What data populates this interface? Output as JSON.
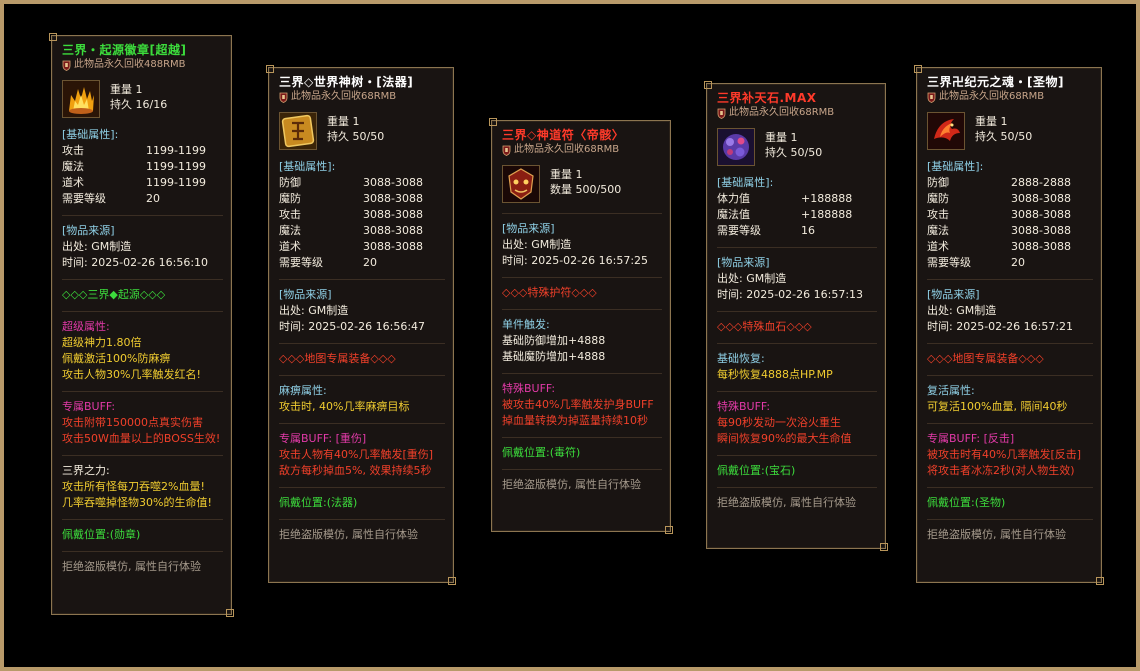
{
  "cards": [
    {
      "title": "三界・起源徽章[超越]",
      "recycle": "此物品永久回收488RMB",
      "weight": "重量 1",
      "dura": "持久 16/16",
      "base_title": "[基础属性]:",
      "attrs": [
        {
          "k": "攻击",
          "v": "1199-1199"
        },
        {
          "k": "魔法",
          "v": "1199-1199"
        },
        {
          "k": "道术",
          "v": "1199-1199"
        },
        {
          "k": "需要等级",
          "v": "20"
        }
      ],
      "source_title": "[物品来源]",
      "source_from": "出处: GM制造",
      "source_time": "时间: 2025-02-26 16:56:10",
      "green_line": "◇◇◇三界◆起源◇◇◇",
      "super_title": "超级属性:",
      "super_lines": [
        "超级神力1.80倍",
        "佩戴激活100%防麻痹",
        "攻击人物30%几率触发红名!"
      ],
      "buff_title": "专属BUFF:",
      "buff_lines": [
        "攻击附带150000点真实伤害",
        "攻击50W血量以上的BOSS生效!"
      ],
      "power_title": "三界之力:",
      "power_lines": [
        "攻击所有怪每刀吞噬2%血量!",
        "几率吞噬掉怪物30%的生命值!"
      ],
      "slot": "佩戴位置:(勋章)",
      "footer": "拒绝盗版模仿, 属性自行体验"
    },
    {
      "title": "三界◇世界神树・[法器]",
      "recycle": "此物品永久回收68RMB",
      "weight": "重量 1",
      "dura": "持久 50/50",
      "base_title": "[基础属性]:",
      "attrs": [
        {
          "k": "防御",
          "v": "3088-3088"
        },
        {
          "k": "魔防",
          "v": "3088-3088"
        },
        {
          "k": "攻击",
          "v": "3088-3088"
        },
        {
          "k": "魔法",
          "v": "3088-3088"
        },
        {
          "k": "道术",
          "v": "3088-3088"
        },
        {
          "k": "需要等级",
          "v": "20"
        }
      ],
      "source_title": "[物品来源]",
      "source_from": "出处: GM制造",
      "source_time": "时间: 2025-02-26 16:56:47",
      "red_line": "◇◇◇地图专属装备◇◇◇",
      "mb_title": "麻痹属性:",
      "mb_lines": [
        "攻击时, 40%几率麻痹目标"
      ],
      "buff_title": "专属BUFF: [重伤]",
      "buff_lines": [
        "攻击人物有40%几率触发[重伤]",
        "敌方每秒掉血5%, 效果持续5秒"
      ],
      "slot": "佩戴位置:(法器)",
      "footer": "拒绝盗版模仿, 属性自行体验"
    },
    {
      "title": "三界◇神道符〈帝骸〉",
      "recycle": "此物品永久回收68RMB",
      "weight": "重量 1",
      "dura": "数量 500/500",
      "source_title": "[物品来源]",
      "source_from": "出处: GM制造",
      "source_time": "时间: 2025-02-26 16:57:25",
      "red_line": "◇◇◇特殊护符◇◇◇",
      "single_title": "单件触发:",
      "single_lines": [
        "基础防御增加+4888",
        "基础魔防增加+4888"
      ],
      "buff_title": "特殊BUFF:",
      "buff_lines": [
        "被攻击40%几率触发护身BUFF",
        "掉血量转换为掉蓝量持续10秒"
      ],
      "slot": "佩戴位置:(毒符)",
      "footer": "拒绝盗版模仿, 属性自行体验"
    },
    {
      "title": "三界补天石.MAX",
      "recycle": "此物品永久回收68RMB",
      "weight": "重量 1",
      "dura": "持久 50/50",
      "base_title": "[基础属性]:",
      "attrs": [
        {
          "k": "体力值",
          "v": "+188888"
        },
        {
          "k": "魔法值",
          "v": "+188888"
        },
        {
          "k": "需要等级",
          "v": "16"
        }
      ],
      "source_title": "[物品来源]",
      "source_from": "出处: GM制造",
      "source_time": "时间: 2025-02-26 16:57:13",
      "red_line": "◇◇◇特殊血石◇◇◇",
      "restore_title": "基础恢复:",
      "restore_lines": [
        "每秒恢复4888点HP.MP"
      ],
      "buff_title": "特殊BUFF:",
      "buff_lines": [
        "每90秒发动一次浴火重生",
        "瞬间恢复90%的最大生命值"
      ],
      "slot": "佩戴位置:(宝石)",
      "footer": "拒绝盗版模仿, 属性自行体验"
    },
    {
      "title": "三界卍纪元之魂・[圣物]",
      "recycle": "此物品永久回收68RMB",
      "weight": "重量 1",
      "dura": "持久 50/50",
      "base_title": "[基础属性]:",
      "attrs": [
        {
          "k": "防御",
          "v": "2888-2888"
        },
        {
          "k": "魔防",
          "v": "3088-3088"
        },
        {
          "k": "攻击",
          "v": "3088-3088"
        },
        {
          "k": "魔法",
          "v": "3088-3088"
        },
        {
          "k": "道术",
          "v": "3088-3088"
        },
        {
          "k": "需要等级",
          "v": "20"
        }
      ],
      "source_title": "[物品来源]",
      "source_from": "出处: GM制造",
      "source_time": "时间: 2025-02-26 16:57:21",
      "red_line": "◇◇◇地图专属装备◇◇◇",
      "revive_title": "复活属性:",
      "revive_lines": [
        "可复活100%血量, 隔间40秒"
      ],
      "buff_title": "专属BUFF: [反击]",
      "buff_lines": [
        "被攻击时有40%几率触发[反击]",
        "将攻击者冰冻2秒(对人物生效)"
      ],
      "slot": "佩戴位置:(圣物)",
      "footer": "拒绝盗版模仿, 属性自行体验"
    }
  ],
  "colors": {
    "title_green": "#3cdc3c",
    "title_white": "#ffffff",
    "title_red": "#ff3a2a",
    "section_cyan": "#8fd0e6",
    "buff_pink": "#e23aa8"
  },
  "icons": [
    "flame-crown-icon",
    "golden-rune-tablet-icon",
    "demon-mask-talisman-icon",
    "purple-gem-stone-icon",
    "red-phoenix-soul-icon"
  ]
}
